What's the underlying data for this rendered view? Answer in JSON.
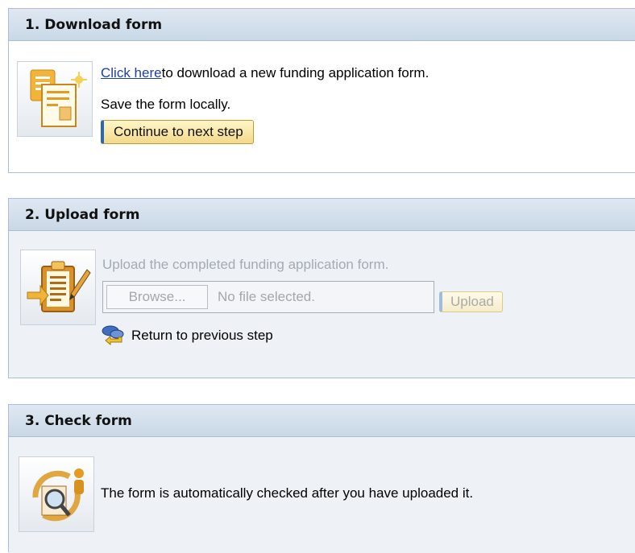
{
  "step1": {
    "title": "1. Download form",
    "icon": "form-document-icon",
    "link_text": "Click here",
    "link_suffix": "to download a new funding application form.",
    "instruction": "Save the form locally.",
    "continue_label": "Continue to next step"
  },
  "step2": {
    "title": "2. Upload form",
    "icon": "clipboard-edit-icon",
    "instruction": "Upload the completed funding application form.",
    "browse_label": "Browse...",
    "file_status": "No file selected.",
    "upload_label": "Upload",
    "return_label": "Return to previous step",
    "return_icon": "return-arrow-icon"
  },
  "step3": {
    "title": "3. Check form",
    "icon": "check-cycle-icon",
    "description": "The form is automatically checked after you have uploaded it."
  },
  "colors": {
    "header_bg": "#cfdceb",
    "panel_border": "#a9bfd6",
    "disabled_body_bg": "#eef2f7",
    "button_bg": "#f3d98a",
    "link": "#1f3fa0"
  }
}
